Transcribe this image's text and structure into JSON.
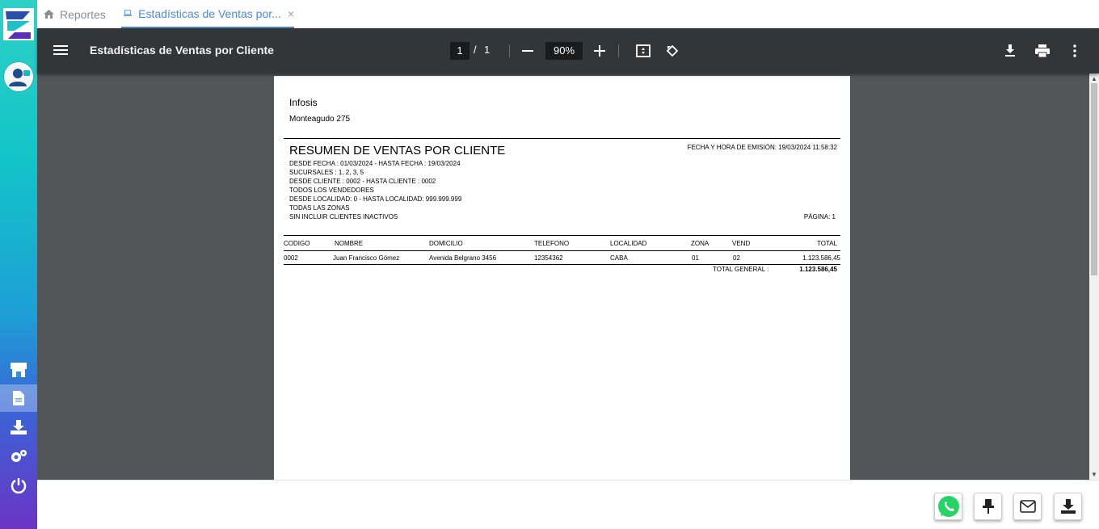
{
  "tabs": {
    "home_label": "Reportes",
    "active_label": "Estadísticas de Ventas por...",
    "close_glyph": "×"
  },
  "toolbar": {
    "title": "Estadísticas de Ventas por Cliente",
    "page_current": "1",
    "page_separator": "/",
    "page_total": "1",
    "zoom": "90%"
  },
  "report": {
    "company": "Infosis",
    "address": "Monteagudo 275",
    "title": "RESUMEN DE VENTAS POR CLIENTE",
    "emision": "FECHA Y HORA DE EMISIÓN: 19/03/2024 11:58:32",
    "filters": [
      "DESDE FECHA : 01/03/2024 - HASTA FECHA : 19/03/2024",
      "SUCURSALES : 1, 2, 3, 5",
      "DESDE CLIENTE : 0002 - HASTA CLIENTE : 0002",
      "TODOS LOS VENDEDORES",
      "DESDE LOCALIDAD: 0 - HASTA LOCALIDAD: 999.999.999",
      "TODAS LAS ZONAS",
      "SIN INCLUIR CLIENTES INACTIVOS"
    ],
    "pagina": "PÁGINA: 1",
    "columns": [
      "CODIGO",
      "NOMBRE",
      "DOMICILIO",
      "TELEFONO",
      "LOCALIDAD",
      "ZONA",
      "VEND",
      "TOTAL"
    ],
    "rows": [
      [
        "0002",
        "Juan Francisco Gómez",
        "Avenida Belgrano 3456",
        "12354362",
        "CABA",
        "01",
        "02",
        "1.123.586,45"
      ]
    ],
    "total_label": "TOTAL GENERAL :",
    "total_value": "1.123.586,45"
  },
  "colors": {
    "accent": "#4a8ad9",
    "toolbar_bg": "#323639",
    "viewer_bg": "#525659",
    "whatsapp": "#25d366"
  },
  "icons": {
    "sidebar": [
      "logo-icon",
      "user-avatar-icon",
      "store-icon",
      "document-icon",
      "download-icon",
      "settings-icon",
      "power-icon"
    ],
    "toolbar": [
      "menu-icon",
      "zoom-out-icon",
      "zoom-in-icon",
      "fit-page-icon",
      "rotate-icon",
      "download-icon",
      "print-icon",
      "more-icon"
    ],
    "footer": [
      "whatsapp-icon",
      "pin-icon",
      "mail-icon",
      "download-icon"
    ]
  }
}
